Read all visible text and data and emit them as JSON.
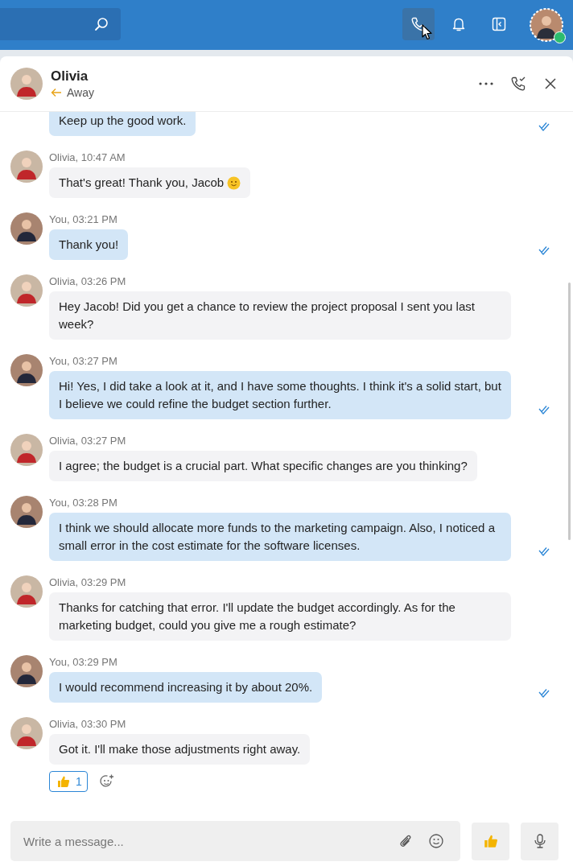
{
  "topbar": {
    "call_active": true,
    "online": true
  },
  "chat_header": {
    "name": "Olivia",
    "status": "Away"
  },
  "messages": [
    {
      "kind": "own",
      "text": "Keep up the good work.",
      "read": true,
      "emoji": false
    },
    {
      "kind": "other",
      "meta": "Olivia, 10:47 AM",
      "text": "That's great! Thank you, Jacob",
      "emoji": true
    },
    {
      "kind": "own",
      "meta": "You, 03:21 PM",
      "text": "Thank you!",
      "read": true,
      "emoji": false
    },
    {
      "kind": "other",
      "meta": "Olivia, 03:26 PM",
      "text": "Hey Jacob! Did you get a chance to review the project proposal I sent you last week?",
      "emoji": false
    },
    {
      "kind": "own",
      "meta": "You, 03:27 PM",
      "text": "Hi! Yes, I did take a look at it, and I have some thoughts. I think it's a solid start, but I believe we could refine the budget section further.",
      "read": true,
      "emoji": false
    },
    {
      "kind": "other",
      "meta": "Olivia, 03:27 PM",
      "text": "I agree; the budget is a crucial part. What specific changes are you thinking?",
      "emoji": false
    },
    {
      "kind": "own",
      "meta": "You, 03:28 PM",
      "text": "I think we should allocate more funds to the marketing campaign. Also, I noticed a small error in the cost estimate for the software licenses.",
      "read": true,
      "emoji": false
    },
    {
      "kind": "other",
      "meta": "Olivia, 03:29 PM",
      "text": "Thanks for catching that error. I'll update the budget accordingly. As for the marketing budget, could you give me a rough estimate?",
      "emoji": false
    },
    {
      "kind": "own",
      "meta": "You, 03:29 PM",
      "text": "I would recommend increasing it by about 20%.",
      "read": true,
      "emoji": false
    },
    {
      "kind": "other",
      "meta": "Olivia, 03:30 PM",
      "text": "Got it. I'll make those adjustments right away.",
      "emoji": false,
      "reaction": {
        "count": "1",
        "selected": true
      }
    }
  ],
  "composer": {
    "placeholder": "Write a message..."
  }
}
